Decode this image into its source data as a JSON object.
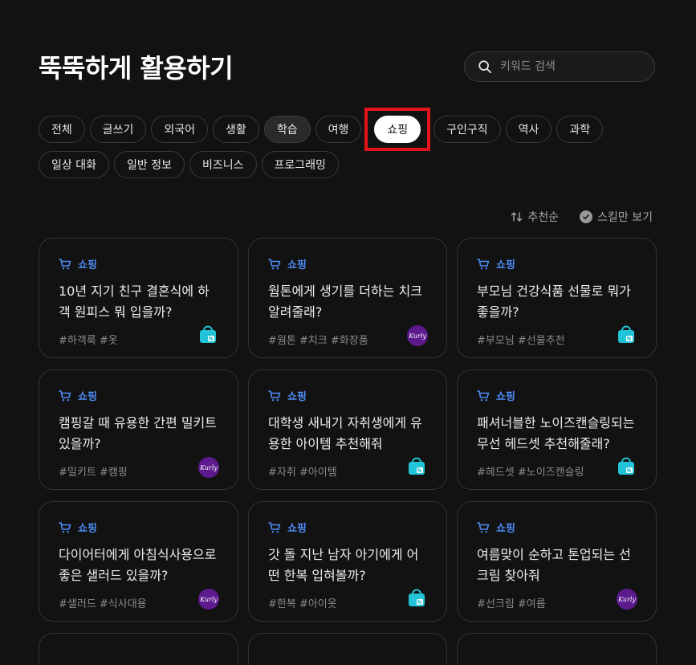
{
  "header": {
    "title": "뚝뚝하게 활용하기",
    "search_placeholder": "키워드 검색"
  },
  "chips_row1": [
    "전체",
    "글쓰기",
    "외국어",
    "생활",
    "학습",
    "여행",
    "쇼핑",
    "구인구직",
    "역사",
    "과학"
  ],
  "chips_row2": [
    "일상 대화",
    "일반 정보",
    "비즈니스",
    "프로그래밍"
  ],
  "active_chip": "쇼핑",
  "sort": {
    "recommend": "추천순",
    "skill_only": "스킬만 보기"
  },
  "cards": [
    {
      "category": "쇼핑",
      "title": "10년 지기 친구 결혼식에 하객 원피스 뭐 입을까?",
      "tags": "#하객룩 #옷",
      "logo": "naver-shopping-icon"
    },
    {
      "category": "쇼핑",
      "title": "웜톤에게 생기를 더하는 치크 알려줄래?",
      "tags": "#웜톤 #치크 #화장품",
      "logo": "kurly-icon"
    },
    {
      "category": "쇼핑",
      "title": "부모님 건강식품 선물로 뭐가 좋을까?",
      "tags": "#부모님 #선물추천",
      "logo": "naver-shopping-icon"
    },
    {
      "category": "쇼핑",
      "title": "캠핑갈 때 유용한 간편 밀키트 있을까?",
      "tags": "#밀키트 #캠핑",
      "logo": "kurly-icon"
    },
    {
      "category": "쇼핑",
      "title": "대학생 새내기 자취생에게 유용한 아이템 추천해줘",
      "tags": "#자취 #아이템",
      "logo": "naver-shopping-icon"
    },
    {
      "category": "쇼핑",
      "title": "패셔너블한 노이즈캔슬링되는 무선 헤드셋 추천해줄래?",
      "tags": "#헤드셋 #노이즈캔슬링",
      "logo": "naver-shopping-icon"
    },
    {
      "category": "쇼핑",
      "title": "다이어터에게 아침식사용으로 좋은 샐러드 있을까?",
      "tags": "#샐러드 #식사대용",
      "logo": "kurly-icon"
    },
    {
      "category": "쇼핑",
      "title": "갓 돌 지난 남자 아기에게 어떤 한복 입혀볼까?",
      "tags": "#한복 #아이옷",
      "logo": "naver-shopping-icon"
    },
    {
      "category": "쇼핑",
      "title": "여름맞이 순하고 톤업되는 선크림 찾아줘",
      "tags": "#선크림 #여름",
      "logo": "kurly-icon"
    }
  ],
  "kurly_text": "Kurly",
  "colors": {
    "accent": "#4e8cf7",
    "highlight": "#e5141b",
    "kurly": "#5c1a8d",
    "naver": "#22c5d8"
  }
}
